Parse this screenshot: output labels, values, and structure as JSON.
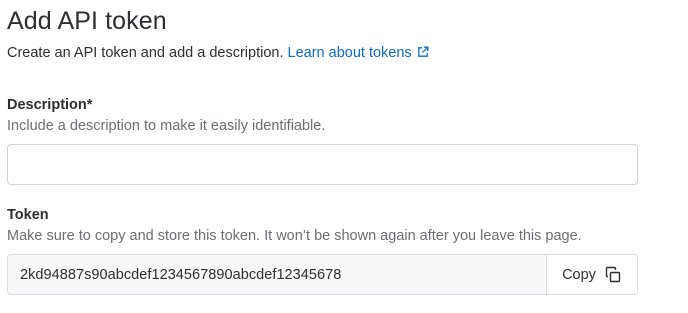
{
  "page": {
    "title": "Add API token",
    "intro_text": "Create an API token and add a description.",
    "intro_link": "Learn about tokens"
  },
  "description": {
    "label": "Description*",
    "help": "Include a description to make it easily identifiable.",
    "value": "",
    "placeholder": ""
  },
  "token": {
    "label": "Token",
    "help": "Make sure to copy and store this token. It won’t be shown again after you leave this page.",
    "value": "2kd94887s90abcdef1234567890abcdef12345678",
    "copy_label": "Copy"
  },
  "icons": {
    "external_link": "external-link-icon",
    "copy": "copy-icon"
  },
  "colors": {
    "link": "#0b6bcb",
    "help_text": "#6a6f75",
    "token_background": "#f6f7f8"
  }
}
